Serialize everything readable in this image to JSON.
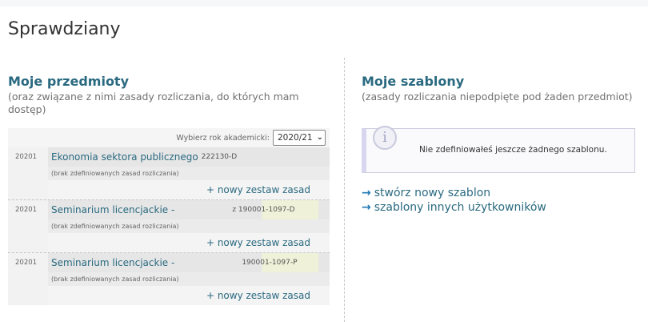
{
  "page": {
    "title": "Sprawdziany"
  },
  "left": {
    "title": "Moje przedmioty",
    "subtitle": "(oraz związane z nimi zasady rozliczania, do których mam dostęp)",
    "year_label": "Wybierz rok akademicki:",
    "year_value": "2020/21",
    "subjects": [
      {
        "cycle": "20201",
        "name": "Ekonomia sektora publicznego",
        "code": "222130-D",
        "rules": "(brak zdefiniowanych zasad rozliczania)",
        "add": "+ nowy zestaw zasad"
      },
      {
        "cycle": "20201",
        "name": "Seminarium licencjackie -",
        "code": "z 190001-1097-D",
        "rules": "(brak zdefiniowanych zasad rozliczania)",
        "add": "+ nowy zestaw zasad"
      },
      {
        "cycle": "20201",
        "name": "Seminarium licencjackie -",
        "code": "190001-1097-P",
        "rules": "(brak zdefiniowanych zasad rozliczania)",
        "add": "+ nowy zestaw zasad"
      }
    ]
  },
  "right": {
    "title": "Moje szablony",
    "subtitle": "(zasady rozliczania niepodpięte pod żaden przedmiot)",
    "info_text": "Nie zdefiniowałeś jeszcze żadnego szablonu.",
    "links": [
      "stwórz nowy szablon",
      "szablony innych użytkowników"
    ]
  },
  "icons": {
    "info": "info-icon",
    "arrow": "arrow-right-icon",
    "select": "chevron-down-icon"
  },
  "colors": {
    "link": "#2a6a80",
    "arrow": "#1d78b4",
    "info_border": "#d7d6ee"
  }
}
